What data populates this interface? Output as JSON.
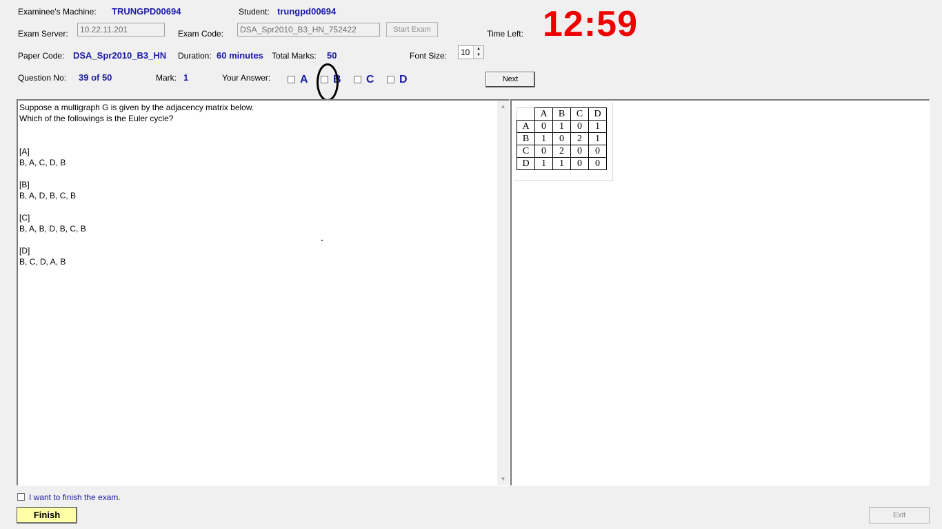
{
  "header": {
    "machine_label": "Examinee's Machine:",
    "machine_value": "TRUNGPD00694",
    "student_label": "Student:",
    "student_value": "trungpd00694",
    "server_label": "Exam Server:",
    "server_value": "10.22.11.201",
    "code_label": "Exam Code:",
    "code_value": "DSA_Spr2010_B3_HN_752422",
    "start_button": "Start Exam",
    "time_left_label": "Time Left:",
    "time_left_value": "12:59",
    "paper_label": "Paper Code:",
    "paper_value": "DSA_Spr2010_B3_HN",
    "duration_label": "Duration:",
    "duration_value": "60 minutes",
    "total_label": "Total Marks:",
    "total_value": "50",
    "font_size_label": "Font Size:",
    "font_size_value": "10"
  },
  "question_bar": {
    "qno_label": "Question No:",
    "qno_value": "39 of 50",
    "mark_label": "Mark:",
    "mark_value": "1",
    "answer_label": "Your Answer:",
    "options": [
      "A",
      "B",
      "C",
      "D"
    ],
    "next_button": "Next"
  },
  "question": {
    "text": "Suppose a multigraph G is given by the adjacency matrix below.\nWhich of the followings is the Euler cycle?\n\n\n[A]\nB, A, C, D, B\n\n[B]\nB, A, D, B, C, B\n\n[C]\nB, A, B, D, B, C, B\n\n[D]\nB, C, D, A, B"
  },
  "matrix": {
    "headers": [
      "A",
      "B",
      "C",
      "D"
    ],
    "rows": [
      {
        "label": "A",
        "cells": [
          "0",
          "1",
          "0",
          "1"
        ]
      },
      {
        "label": "B",
        "cells": [
          "1",
          "0",
          "2",
          "1"
        ]
      },
      {
        "label": "C",
        "cells": [
          "0",
          "2",
          "0",
          "0"
        ]
      },
      {
        "label": "D",
        "cells": [
          "1",
          "1",
          "0",
          "0"
        ]
      }
    ]
  },
  "footer": {
    "finish_checkbox_label": "I want to finish the exam.",
    "finish_button": "Finish",
    "exit_button": "Exit"
  },
  "colors": {
    "value_blue": "#1a1aa6",
    "timer_red": "#ee0000",
    "finish_yellow": "#ffffa8"
  }
}
